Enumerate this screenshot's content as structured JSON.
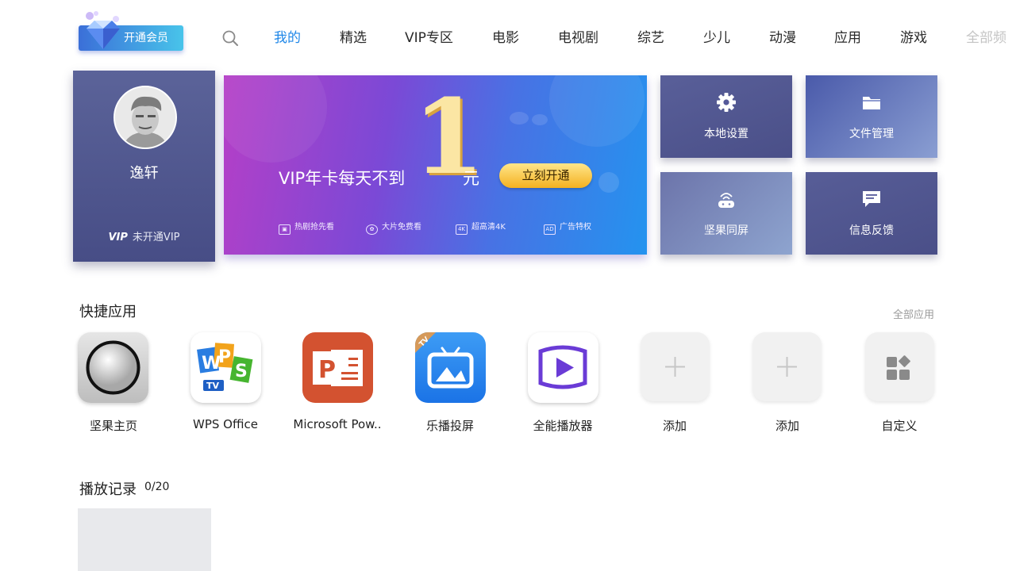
{
  "header": {
    "vip_button": "开通会员",
    "nav": [
      "我的",
      "精选",
      "VIP专区",
      "电影",
      "电视剧",
      "综艺",
      "少儿",
      "动漫",
      "应用",
      "游戏",
      "全部频"
    ]
  },
  "profile": {
    "username": "逸轩",
    "vip_badge": "VIP",
    "vip_status": "未开通VIP"
  },
  "banner": {
    "headline": "VIP年卡每天不到",
    "number": "1",
    "unit": "元",
    "cta": "立刻开通",
    "features": [
      {
        "icon": "▣",
        "label": "热剧抢先看"
      },
      {
        "icon": "✿",
        "label": "大片免费看"
      },
      {
        "icon": "4K",
        "label": "超高清4K"
      },
      {
        "icon": "AD",
        "label": "广告特权"
      }
    ]
  },
  "tiles": {
    "local_settings": "本地设置",
    "file_manager": "文件管理",
    "screen_mirror": "坚果同屏",
    "feedback": "信息反馈"
  },
  "quick_apps": {
    "title": "快捷应用",
    "more": "全部应用",
    "items": [
      "坚果主页",
      "WPS Office",
      "Microsoft Pow..",
      "乐播投屏",
      "全能播放器",
      "添加",
      "添加",
      "自定义"
    ]
  },
  "history": {
    "title": "播放记录",
    "count": "0/20"
  },
  "colors": {
    "accent": "#1f87e8",
    "profile_bg": "#474d86",
    "banner_left": "#b53fc7",
    "banner_right": "#2493ef"
  }
}
